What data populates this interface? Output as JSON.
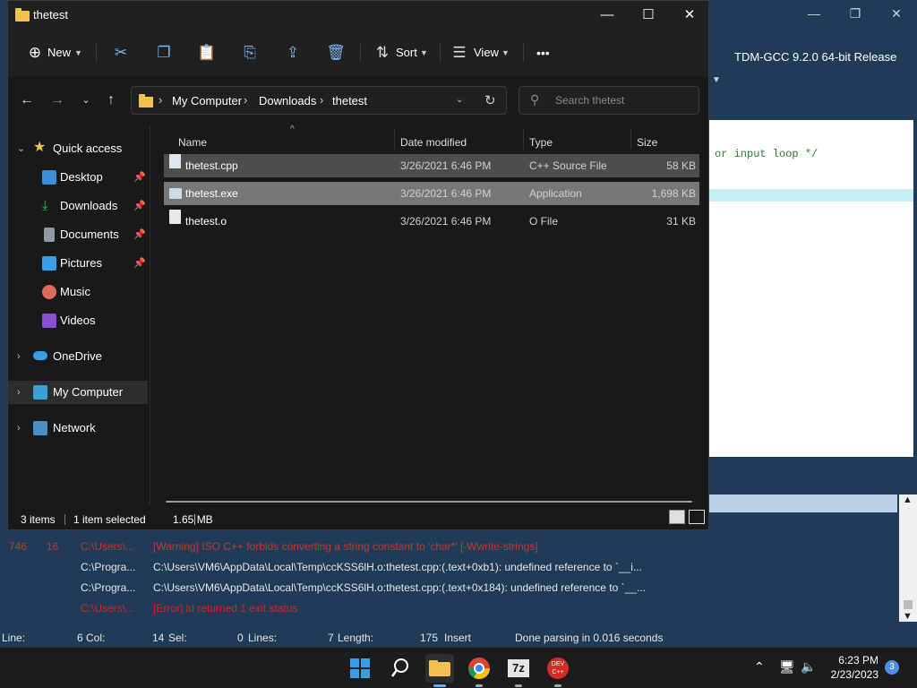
{
  "background_app": {
    "compiler_label": "TDM-GCC 9.2.0 64-bit Release",
    "code_line": "or input loop */",
    "log_rows": [
      {
        "line": "746",
        "col": "16",
        "file": "C:\\Users\\...",
        "message": "[Warning] ISO C++ forbids converting a string constant to 'char*' [-Wwrite-strings]",
        "kind": "warn"
      },
      {
        "line": "",
        "col": "",
        "file": "C:\\Progra...",
        "message": "C:\\Users\\VM6\\AppData\\Local\\Temp\\ccKSS6lH.o:thetest.cpp:(.text+0xb1): undefined reference to `__i...",
        "kind": "norm"
      },
      {
        "line": "",
        "col": "",
        "file": "C:\\Progra...",
        "message": "C:\\Users\\VM6\\AppData\\Local\\Temp\\ccKSS6lH.o:thetest.cpp:(.text+0x184): undefined reference to `__...",
        "kind": "norm"
      },
      {
        "line": "",
        "col": "",
        "file": "C:\\Users\\...",
        "message": "[Error] ld returned 1 exit status",
        "kind": "err"
      }
    ],
    "status": {
      "line_label": "Line:",
      "line_val": "6",
      "col_label": "Col:",
      "col_val": "14",
      "sel_label": "Sel:",
      "sel_val": "0",
      "lines_label": "Lines:",
      "lines_val": "7",
      "length_label": "Length:",
      "length_val": "175",
      "mode": "Insert",
      "message": "Done parsing in 0.016 seconds"
    }
  },
  "explorer": {
    "title": "thetest",
    "toolbar": {
      "new_label": "New",
      "sort_label": "Sort",
      "view_label": "View",
      "more_label": "•••"
    },
    "breadcrumb": [
      "My Computer",
      "Downloads",
      "thetest"
    ],
    "search_placeholder": "Search thetest",
    "sidebar": {
      "quick_access": "Quick access",
      "items": [
        {
          "label": "Desktop",
          "pinned": true,
          "icon": "desktop-icon",
          "color": "#3a8fd6"
        },
        {
          "label": "Downloads",
          "pinned": true,
          "icon": "download-icon",
          "color": "#3cba6a"
        },
        {
          "label": "Documents",
          "pinned": true,
          "icon": "documents-icon",
          "color": "#8e9aa8"
        },
        {
          "label": "Pictures",
          "pinned": true,
          "icon": "pictures-icon",
          "color": "#3a9ee6"
        },
        {
          "label": "Music",
          "pinned": false,
          "icon": "music-icon",
          "color": "#e06a5a"
        },
        {
          "label": "Videos",
          "pinned": false,
          "icon": "videos-icon",
          "color": "#8a4fd6"
        }
      ],
      "onedrive": "OneDrive",
      "my_computer": "My Computer",
      "network": "Network"
    },
    "columns": [
      "Name",
      "Date modified",
      "Type",
      "Size"
    ],
    "files": [
      {
        "name": "thetest.cpp",
        "date": "3/26/2021 6:46 PM",
        "type": "C++ Source File",
        "size": "58 KB"
      },
      {
        "name": "thetest.exe",
        "date": "3/26/2021 6:46 PM",
        "type": "Application",
        "size": "1,698 KB"
      },
      {
        "name": "thetest.o",
        "date": "3/26/2021 6:46 PM",
        "type": "O File",
        "size": "31 KB"
      }
    ],
    "status": {
      "items": "3 items",
      "selected": "1 item selected",
      "selected_size": "1.65 MB"
    }
  },
  "taskbar": {
    "apps": [
      "start-icon",
      "search-icon",
      "file-explorer-icon",
      "chrome-icon",
      "7zip-icon",
      "devcpp-icon"
    ],
    "sevenzip_label": "7z",
    "devcpp_label": "DEV C++",
    "time": "6:23 PM",
    "date": "2/23/2023",
    "notifications": "3"
  },
  "colors": {
    "accent": "#7fb5ea",
    "folder": "#f2c14e",
    "warning": "#c0392b",
    "error": "#e01e1e"
  }
}
